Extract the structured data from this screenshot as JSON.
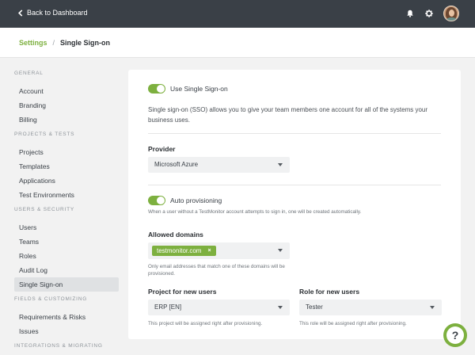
{
  "topbar": {
    "back_label": "Back to Dashboard",
    "icons": [
      "bell-icon",
      "gear-icon",
      "avatar"
    ]
  },
  "breadcrumb": {
    "parent": "Settings",
    "separator": "/",
    "current": "Single Sign-on"
  },
  "sidebar": {
    "sections": [
      {
        "title": "GENERAL",
        "items": [
          "Account",
          "Branding",
          "Billing"
        ]
      },
      {
        "title": "PROJECTS & TESTS",
        "items": [
          "Projects",
          "Templates",
          "Applications",
          "Test Environments"
        ]
      },
      {
        "title": "USERS & SECURITY",
        "items": [
          "Users",
          "Teams",
          "Roles",
          "Audit Log",
          "Single Sign-on"
        ]
      },
      {
        "title": "FIELDS & CUSTOMIZING",
        "items": [
          "Requirements & Risks",
          "Issues"
        ]
      },
      {
        "title": "INTEGRATIONS & MIGRATING",
        "items": []
      }
    ],
    "active_item": "Single Sign-on"
  },
  "sso": {
    "toggle_label": "Use Single Sign-on",
    "enabled": true,
    "description": "Single sign-on (SSO) allows you to give your team members one account for all of the systems your business uses."
  },
  "provider": {
    "label": "Provider",
    "value": "Microsoft Azure"
  },
  "auto_provisioning": {
    "toggle_label": "Auto provisioning",
    "enabled": true,
    "hint": "When a user without a TestMonitor account attempts to sign in, one will be created automatically."
  },
  "allowed_domains": {
    "label": "Allowed domains",
    "tags": [
      "testmonitor.com"
    ],
    "remove_symbol": "×",
    "hint": "Only email addresses that match one of these domains will be provisioned."
  },
  "project_for_new_users": {
    "label": "Project for new users",
    "value": "ERP [EN]",
    "hint": "This project will be assigned right after provisioning."
  },
  "role_for_new_users": {
    "label": "Role for new users",
    "value": "Tester",
    "hint": "This role will be assigned right after provisioning."
  },
  "help": {
    "symbol": "?"
  },
  "colors": {
    "accent": "#7db03f",
    "topbar": "#3a4047",
    "page_bg": "#f2f2f2"
  }
}
